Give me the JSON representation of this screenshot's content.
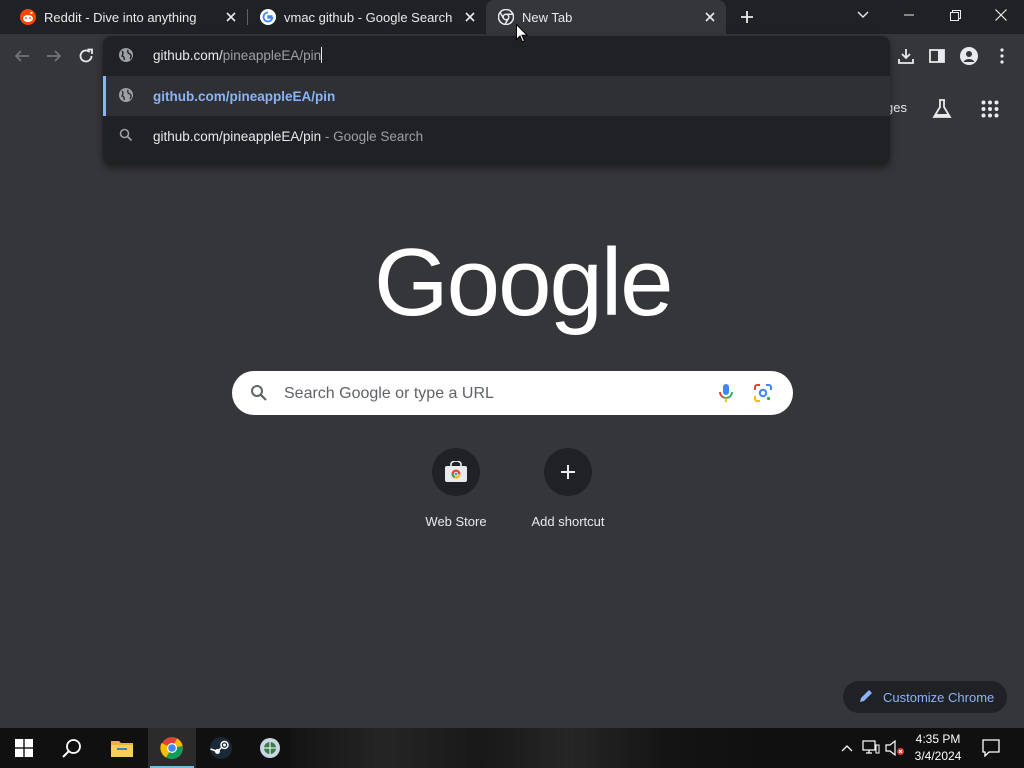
{
  "tabs": [
    {
      "title": "Reddit - Dive into anything",
      "favicon": "reddit-icon",
      "active": false
    },
    {
      "title": "vmac github - Google Search",
      "favicon": "google-icon",
      "active": false
    },
    {
      "title": "New Tab",
      "favicon": "chrome-icon",
      "active": true
    }
  ],
  "omnibox": {
    "typed": "github.com/",
    "autocomplete": "pineappleEA/pin",
    "suggestions": [
      {
        "label": "github.com/pineappleEA/pin",
        "suffix": "",
        "icon": "globe-icon"
      },
      {
        "label": "github.com/pineappleEA/pin",
        "suffix": " - Google Search",
        "icon": "search-icon"
      }
    ]
  },
  "ntp": {
    "images_label_fragment": "ges",
    "logo_text": "Google",
    "search_placeholder": "Search Google or type a URL",
    "shortcuts": [
      {
        "label": "Web Store",
        "icon": "web-store-icon"
      },
      {
        "label": "Add shortcut",
        "icon": "plus-icon"
      }
    ],
    "customize_label": "Customize Chrome"
  },
  "taskbar": {
    "time": "4:35 PM",
    "date": "3/4/2024"
  },
  "colors": {
    "tabstrip_bg": "#202124",
    "toolbar_bg": "#35363a",
    "accent_blue": "#8ab4f8",
    "text": "#e8eaed",
    "taskbar_bg": "#101010"
  }
}
